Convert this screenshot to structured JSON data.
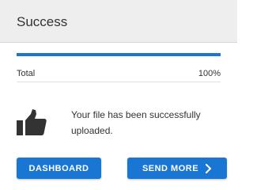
{
  "header": {
    "title": "Success"
  },
  "progress": {
    "value_percent": 100,
    "color": "#1976d2"
  },
  "total": {
    "label": "Total",
    "value": "100%"
  },
  "message": {
    "text": "Your file has been successfully uploaded.",
    "icon": "thumbs-up-icon"
  },
  "buttons": {
    "dashboard_label": "DASHBOARD",
    "send_more_label": "SEND MORE",
    "send_more_icon": "chevron-right-icon",
    "color": "#1976d2"
  }
}
